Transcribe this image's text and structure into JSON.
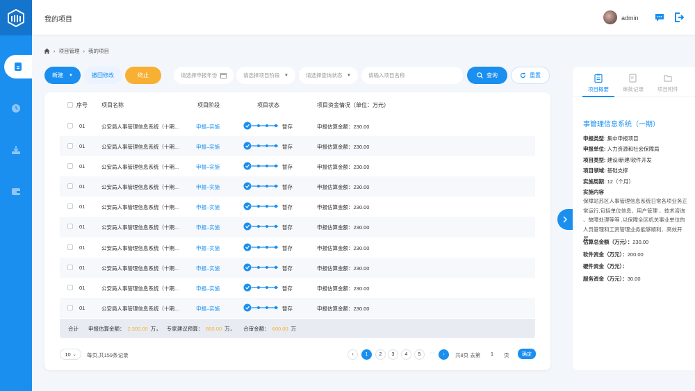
{
  "header": {
    "page_title": "我的项目",
    "username": "admin"
  },
  "breadcrumb": {
    "items": [
      "项目管理",
      "我的项目"
    ]
  },
  "toolbar": {
    "new_label": "新建",
    "return_label": "撤回修改",
    "stop_label": "终止",
    "year_placeholder": "请选择申报年份",
    "stage_placeholder": "请选择项目阶段",
    "status_placeholder": "请选择查询状态",
    "name_placeholder": "请输入项目名称",
    "query_label": "查询",
    "reset_label": "重置"
  },
  "table": {
    "headers": [
      "序号",
      "项目名称",
      "项目阶段",
      "项目状态",
      "项目资金情况（单位：万元）"
    ],
    "rows": [
      {
        "no": "01",
        "name": "公安局人事管理信息系统（十期...",
        "stage": "申报–实施",
        "status": "暂存",
        "fund": "申报估算金额：230.00"
      },
      {
        "no": "01",
        "name": "公安局人事管理信息系统（十期...",
        "stage": "申报–实施",
        "status": "暂存",
        "fund": "申报估算金额：230.00"
      },
      {
        "no": "01",
        "name": "公安局人事管理信息系统（十期...",
        "stage": "申报–实施",
        "status": "暂存",
        "fund": "申报估算金额：230.00"
      },
      {
        "no": "01",
        "name": "公安局人事管理信息系统（十期...",
        "stage": "申报–实施",
        "status": "暂存",
        "fund": "申报估算金额：230.00"
      },
      {
        "no": "01",
        "name": "公安局人事管理信息系统（十期...",
        "stage": "申报–实施",
        "status": "暂存",
        "fund": "申报估算金额：230.00"
      },
      {
        "no": "01",
        "name": "公安局人事管理信息系统（十期...",
        "stage": "申报–实施",
        "status": "暂存",
        "fund": "申报估算金额：230.00"
      },
      {
        "no": "01",
        "name": "公安局人事管理信息系统（十期...",
        "stage": "申报–实施",
        "status": "暂存",
        "fund": "申报估算金额：230.00"
      },
      {
        "no": "01",
        "name": "公安局人事管理信息系统（十期...",
        "stage": "申报–实施",
        "status": "暂存",
        "fund": "申报估算金额：230.00"
      },
      {
        "no": "01",
        "name": "公安局人事管理信息系统（十期...",
        "stage": "申报–实施",
        "status": "暂存",
        "fund": "申报估算金额：230.00"
      },
      {
        "no": "01",
        "name": "公安局人事管理信息系统（十期...",
        "stage": "申报–实施",
        "status": "暂存",
        "fund": "申报估算金额：230.00"
      }
    ],
    "total": {
      "label": "合计",
      "declare_label": "申报估算金额：",
      "declare_value": "2,300.00",
      "declare_unit": "万，",
      "expert_label": "专家建议预算：",
      "expert_value": "800.00",
      "expert_unit": "万，",
      "audit_label": "合审金额：",
      "audit_value": "600.00",
      "audit_unit": "万"
    }
  },
  "pagination": {
    "page_size": "10",
    "info": "每页,共159条记录",
    "pages": [
      "1",
      "2",
      "3",
      "4",
      "5"
    ],
    "dots": "···",
    "total_pages": "共8页 去第",
    "goto_value": "1",
    "unit": "页",
    "confirm_label": "确定"
  },
  "detail": {
    "tabs": [
      "项目概要",
      "审批记录",
      "项目附件"
    ],
    "title": "事管理信息系统（一期）",
    "fields": [
      {
        "label": "申报类型:",
        "value": "集中申报项目"
      },
      {
        "label": "申报单位:",
        "value": "人力资源和社会保障局"
      },
      {
        "label": "项目类型:",
        "value": "建设/新建/软件开发"
      },
      {
        "label": "项目领域:",
        "value": "基础支撑"
      },
      {
        "label": "实施周期:",
        "value": "12（个月）"
      },
      {
        "label": "实施内容",
        "value": ""
      }
    ],
    "description": "保障站苏区人事管理信息系统日常各项业务正常运行,包括单位信息、用户管理 、技术咨询 、故障处理等等 ,以保障全区机关事业单位的人员管理和工资管理业务能够顺利、高效开展。",
    "funds": [
      {
        "label": "估算总金额（万元）：",
        "value": "230.00"
      },
      {
        "label": "软件资金（万元）：",
        "value": "200.00"
      },
      {
        "label": "硬件资金（万元）：",
        "value": ""
      },
      {
        "label": "服务资金（万元）：",
        "value": "30.00"
      }
    ]
  },
  "colors": {
    "primary": "#1a8ff0",
    "warning": "#f7b034",
    "sidebar": "#1a8ff0",
    "logo_bg": "#1574cc"
  },
  "icons": [
    "logo-icon",
    "document-icon",
    "clock-icon",
    "download-icon",
    "wallet-icon",
    "chat-icon",
    "logout-icon",
    "home-icon",
    "search-icon",
    "refresh-icon",
    "calendar-icon"
  ]
}
